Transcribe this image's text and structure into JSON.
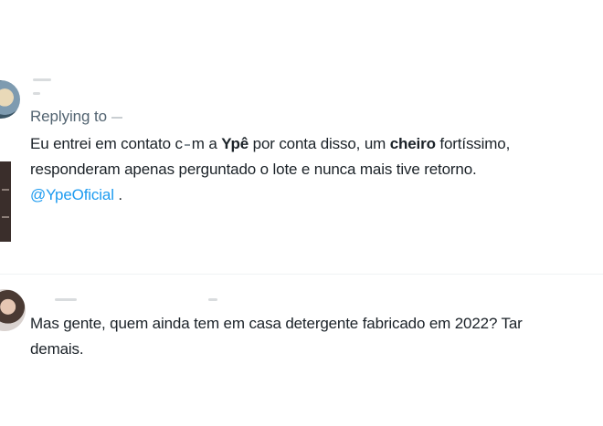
{
  "tweets": [
    {
      "replying_to_label": "Replying to",
      "lines": [
        {
          "p1": "Eu entrei em contato c",
          "p2": "m a ",
          "b1": "Ypê",
          "p3": " por conta disso, um ",
          "b2": "cheiro",
          "p4": " fortíssimo,"
        },
        {
          "text": "responderam apenas perguntado o lote e nunca mais tive retorno."
        },
        {
          "mention": "@YpeOficial",
          "tail": " ."
        }
      ]
    },
    {
      "lines": [
        {
          "text": "Mas gente, quem ainda tem em casa detergente fabricado em 2022? Tar"
        },
        {
          "text": "demais."
        }
      ]
    }
  ],
  "icons": {
    "avatar_1": "avatar-image",
    "avatar_2": "avatar-image"
  }
}
